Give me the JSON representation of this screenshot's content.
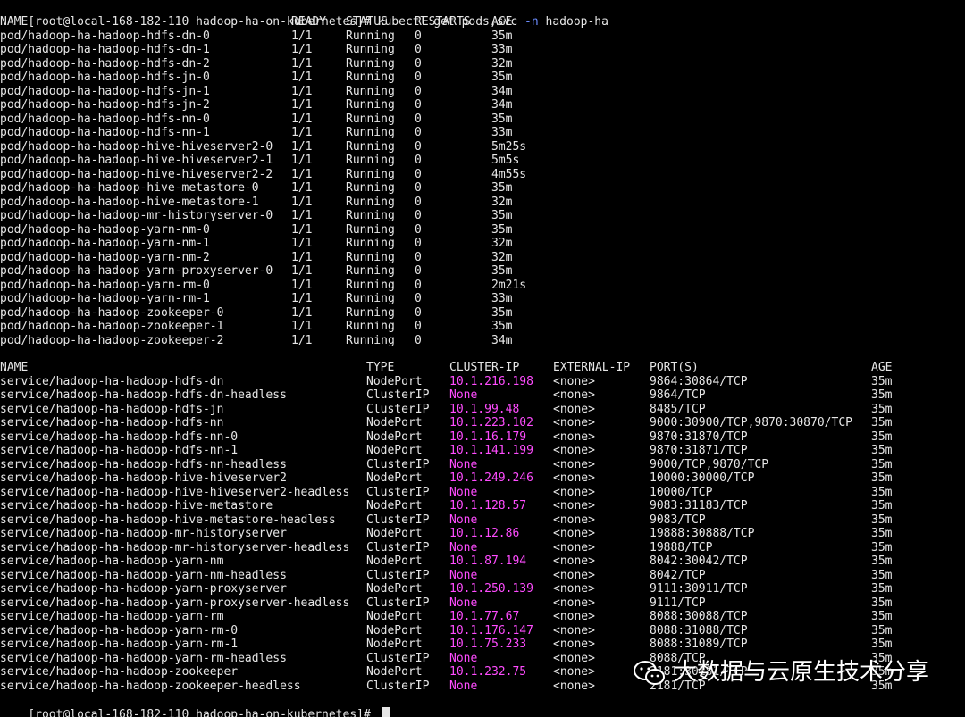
{
  "prompt": {
    "text": "[root@local-168-182-110 hadoop-ha-on-kubernetes]# ",
    "command": "kubectl get pods,svc ",
    "flag": "-n",
    "namespace": " hadoop-ha"
  },
  "pods": {
    "headers": [
      "NAME",
      "READY",
      "STATUS",
      "RESTARTS",
      "AGE"
    ],
    "rows": [
      [
        "pod/hadoop-ha-hadoop-hdfs-dn-0",
        "1/1",
        "Running",
        "0",
        "35m"
      ],
      [
        "pod/hadoop-ha-hadoop-hdfs-dn-1",
        "1/1",
        "Running",
        "0",
        "33m"
      ],
      [
        "pod/hadoop-ha-hadoop-hdfs-dn-2",
        "1/1",
        "Running",
        "0",
        "32m"
      ],
      [
        "pod/hadoop-ha-hadoop-hdfs-jn-0",
        "1/1",
        "Running",
        "0",
        "35m"
      ],
      [
        "pod/hadoop-ha-hadoop-hdfs-jn-1",
        "1/1",
        "Running",
        "0",
        "34m"
      ],
      [
        "pod/hadoop-ha-hadoop-hdfs-jn-2",
        "1/1",
        "Running",
        "0",
        "34m"
      ],
      [
        "pod/hadoop-ha-hadoop-hdfs-nn-0",
        "1/1",
        "Running",
        "0",
        "35m"
      ],
      [
        "pod/hadoop-ha-hadoop-hdfs-nn-1",
        "1/1",
        "Running",
        "0",
        "33m"
      ],
      [
        "pod/hadoop-ha-hadoop-hive-hiveserver2-0",
        "1/1",
        "Running",
        "0",
        "5m25s"
      ],
      [
        "pod/hadoop-ha-hadoop-hive-hiveserver2-1",
        "1/1",
        "Running",
        "0",
        "5m5s"
      ],
      [
        "pod/hadoop-ha-hadoop-hive-hiveserver2-2",
        "1/1",
        "Running",
        "0",
        "4m55s"
      ],
      [
        "pod/hadoop-ha-hadoop-hive-metastore-0",
        "1/1",
        "Running",
        "0",
        "35m"
      ],
      [
        "pod/hadoop-ha-hadoop-hive-metastore-1",
        "1/1",
        "Running",
        "0",
        "32m"
      ],
      [
        "pod/hadoop-ha-hadoop-mr-historyserver-0",
        "1/1",
        "Running",
        "0",
        "35m"
      ],
      [
        "pod/hadoop-ha-hadoop-yarn-nm-0",
        "1/1",
        "Running",
        "0",
        "35m"
      ],
      [
        "pod/hadoop-ha-hadoop-yarn-nm-1",
        "1/1",
        "Running",
        "0",
        "32m"
      ],
      [
        "pod/hadoop-ha-hadoop-yarn-nm-2",
        "1/1",
        "Running",
        "0",
        "32m"
      ],
      [
        "pod/hadoop-ha-hadoop-yarn-proxyserver-0",
        "1/1",
        "Running",
        "0",
        "35m"
      ],
      [
        "pod/hadoop-ha-hadoop-yarn-rm-0",
        "1/1",
        "Running",
        "0",
        "2m21s"
      ],
      [
        "pod/hadoop-ha-hadoop-yarn-rm-1",
        "1/1",
        "Running",
        "0",
        "33m"
      ],
      [
        "pod/hadoop-ha-hadoop-zookeeper-0",
        "1/1",
        "Running",
        "0",
        "35m"
      ],
      [
        "pod/hadoop-ha-hadoop-zookeeper-1",
        "1/1",
        "Running",
        "0",
        "35m"
      ],
      [
        "pod/hadoop-ha-hadoop-zookeeper-2",
        "1/1",
        "Running",
        "0",
        "34m"
      ]
    ]
  },
  "services": {
    "headers": [
      "NAME",
      "TYPE",
      "CLUSTER-IP",
      "EXTERNAL-IP",
      "PORT(S)",
      "AGE"
    ],
    "rows": [
      [
        "service/hadoop-ha-hadoop-hdfs-dn",
        "NodePort",
        "10.1.216.198",
        "<none>",
        "9864:30864/TCP",
        "35m"
      ],
      [
        "service/hadoop-ha-hadoop-hdfs-dn-headless",
        "ClusterIP",
        "None",
        "<none>",
        "9864/TCP",
        "35m"
      ],
      [
        "service/hadoop-ha-hadoop-hdfs-jn",
        "ClusterIP",
        "10.1.99.48",
        "<none>",
        "8485/TCP",
        "35m"
      ],
      [
        "service/hadoop-ha-hadoop-hdfs-nn",
        "NodePort",
        "10.1.223.102",
        "<none>",
        "9000:30900/TCP,9870:30870/TCP",
        "35m"
      ],
      [
        "service/hadoop-ha-hadoop-hdfs-nn-0",
        "NodePort",
        "10.1.16.179",
        "<none>",
        "9870:31870/TCP",
        "35m"
      ],
      [
        "service/hadoop-ha-hadoop-hdfs-nn-1",
        "NodePort",
        "10.1.141.199",
        "<none>",
        "9870:31871/TCP",
        "35m"
      ],
      [
        "service/hadoop-ha-hadoop-hdfs-nn-headless",
        "ClusterIP",
        "None",
        "<none>",
        "9000/TCP,9870/TCP",
        "35m"
      ],
      [
        "service/hadoop-ha-hadoop-hive-hiveserver2",
        "NodePort",
        "10.1.249.246",
        "<none>",
        "10000:30000/TCP",
        "35m"
      ],
      [
        "service/hadoop-ha-hadoop-hive-hiveserver2-headless",
        "ClusterIP",
        "None",
        "<none>",
        "10000/TCP",
        "35m"
      ],
      [
        "service/hadoop-ha-hadoop-hive-metastore",
        "NodePort",
        "10.1.128.57",
        "<none>",
        "9083:31183/TCP",
        "35m"
      ],
      [
        "service/hadoop-ha-hadoop-hive-metastore-headless",
        "ClusterIP",
        "None",
        "<none>",
        "9083/TCP",
        "35m"
      ],
      [
        "service/hadoop-ha-hadoop-mr-historyserver",
        "NodePort",
        "10.1.12.86",
        "<none>",
        "19888:30888/TCP",
        "35m"
      ],
      [
        "service/hadoop-ha-hadoop-mr-historyserver-headless",
        "ClusterIP",
        "None",
        "<none>",
        "19888/TCP",
        "35m"
      ],
      [
        "service/hadoop-ha-hadoop-yarn-nm",
        "NodePort",
        "10.1.87.194",
        "<none>",
        "8042:30042/TCP",
        "35m"
      ],
      [
        "service/hadoop-ha-hadoop-yarn-nm-headless",
        "ClusterIP",
        "None",
        "<none>",
        "8042/TCP",
        "35m"
      ],
      [
        "service/hadoop-ha-hadoop-yarn-proxyserver",
        "NodePort",
        "10.1.250.139",
        "<none>",
        "9111:30911/TCP",
        "35m"
      ],
      [
        "service/hadoop-ha-hadoop-yarn-proxyserver-headless",
        "ClusterIP",
        "None",
        "<none>",
        "9111/TCP",
        "35m"
      ],
      [
        "service/hadoop-ha-hadoop-yarn-rm",
        "NodePort",
        "10.1.77.67",
        "<none>",
        "8088:30088/TCP",
        "35m"
      ],
      [
        "service/hadoop-ha-hadoop-yarn-rm-0",
        "NodePort",
        "10.1.176.147",
        "<none>",
        "8088:31088/TCP",
        "35m"
      ],
      [
        "service/hadoop-ha-hadoop-yarn-rm-1",
        "NodePort",
        "10.1.75.233",
        "<none>",
        "8088:31089/TCP",
        "35m"
      ],
      [
        "service/hadoop-ha-hadoop-yarn-rm-headless",
        "ClusterIP",
        "None",
        "<none>",
        "8088/TCP",
        "35m"
      ],
      [
        "service/hadoop-ha-hadoop-zookeeper",
        "NodePort",
        "10.1.232.75",
        "<none>",
        "2181:30181/TCP",
        "35m"
      ],
      [
        "service/hadoop-ha-hadoop-zookeeper-headless",
        "ClusterIP",
        "None",
        "<none>",
        "2181/TCP",
        "35m"
      ]
    ]
  },
  "final_prompt": "[root@local-168-182-110 hadoop-ha-on-kubernetes]# ",
  "watermark": {
    "icon": "wechat-icon",
    "text": "大数据与云原生技术分享"
  },
  "colors": {
    "background": "#000000",
    "foreground": "#e6e6e6",
    "cluster_ip": "#ff4cff",
    "flag": "#6b8cff"
  }
}
